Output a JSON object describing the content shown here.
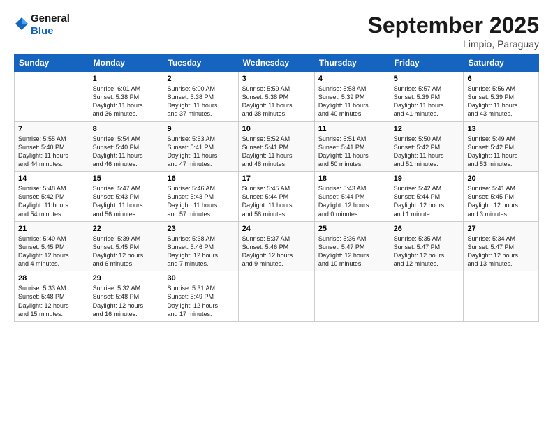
{
  "header": {
    "logo_general": "General",
    "logo_blue": "Blue",
    "month_title": "September 2025",
    "location": "Limpio, Paraguay"
  },
  "columns": [
    "Sunday",
    "Monday",
    "Tuesday",
    "Wednesday",
    "Thursday",
    "Friday",
    "Saturday"
  ],
  "weeks": [
    [
      {
        "day": "",
        "info": ""
      },
      {
        "day": "1",
        "info": "Sunrise: 6:01 AM\nSunset: 5:38 PM\nDaylight: 11 hours\nand 36 minutes."
      },
      {
        "day": "2",
        "info": "Sunrise: 6:00 AM\nSunset: 5:38 PM\nDaylight: 11 hours\nand 37 minutes."
      },
      {
        "day": "3",
        "info": "Sunrise: 5:59 AM\nSunset: 5:38 PM\nDaylight: 11 hours\nand 38 minutes."
      },
      {
        "day": "4",
        "info": "Sunrise: 5:58 AM\nSunset: 5:39 PM\nDaylight: 11 hours\nand 40 minutes."
      },
      {
        "day": "5",
        "info": "Sunrise: 5:57 AM\nSunset: 5:39 PM\nDaylight: 11 hours\nand 41 minutes."
      },
      {
        "day": "6",
        "info": "Sunrise: 5:56 AM\nSunset: 5:39 PM\nDaylight: 11 hours\nand 43 minutes."
      }
    ],
    [
      {
        "day": "7",
        "info": "Sunrise: 5:55 AM\nSunset: 5:40 PM\nDaylight: 11 hours\nand 44 minutes."
      },
      {
        "day": "8",
        "info": "Sunrise: 5:54 AM\nSunset: 5:40 PM\nDaylight: 11 hours\nand 46 minutes."
      },
      {
        "day": "9",
        "info": "Sunrise: 5:53 AM\nSunset: 5:41 PM\nDaylight: 11 hours\nand 47 minutes."
      },
      {
        "day": "10",
        "info": "Sunrise: 5:52 AM\nSunset: 5:41 PM\nDaylight: 11 hours\nand 48 minutes."
      },
      {
        "day": "11",
        "info": "Sunrise: 5:51 AM\nSunset: 5:41 PM\nDaylight: 11 hours\nand 50 minutes."
      },
      {
        "day": "12",
        "info": "Sunrise: 5:50 AM\nSunset: 5:42 PM\nDaylight: 11 hours\nand 51 minutes."
      },
      {
        "day": "13",
        "info": "Sunrise: 5:49 AM\nSunset: 5:42 PM\nDaylight: 11 hours\nand 53 minutes."
      }
    ],
    [
      {
        "day": "14",
        "info": "Sunrise: 5:48 AM\nSunset: 5:42 PM\nDaylight: 11 hours\nand 54 minutes."
      },
      {
        "day": "15",
        "info": "Sunrise: 5:47 AM\nSunset: 5:43 PM\nDaylight: 11 hours\nand 56 minutes."
      },
      {
        "day": "16",
        "info": "Sunrise: 5:46 AM\nSunset: 5:43 PM\nDaylight: 11 hours\nand 57 minutes."
      },
      {
        "day": "17",
        "info": "Sunrise: 5:45 AM\nSunset: 5:44 PM\nDaylight: 11 hours\nand 58 minutes."
      },
      {
        "day": "18",
        "info": "Sunrise: 5:43 AM\nSunset: 5:44 PM\nDaylight: 12 hours\nand 0 minutes."
      },
      {
        "day": "19",
        "info": "Sunrise: 5:42 AM\nSunset: 5:44 PM\nDaylight: 12 hours\nand 1 minute."
      },
      {
        "day": "20",
        "info": "Sunrise: 5:41 AM\nSunset: 5:45 PM\nDaylight: 12 hours\nand 3 minutes."
      }
    ],
    [
      {
        "day": "21",
        "info": "Sunrise: 5:40 AM\nSunset: 5:45 PM\nDaylight: 12 hours\nand 4 minutes."
      },
      {
        "day": "22",
        "info": "Sunrise: 5:39 AM\nSunset: 5:45 PM\nDaylight: 12 hours\nand 6 minutes."
      },
      {
        "day": "23",
        "info": "Sunrise: 5:38 AM\nSunset: 5:46 PM\nDaylight: 12 hours\nand 7 minutes."
      },
      {
        "day": "24",
        "info": "Sunrise: 5:37 AM\nSunset: 5:46 PM\nDaylight: 12 hours\nand 9 minutes."
      },
      {
        "day": "25",
        "info": "Sunrise: 5:36 AM\nSunset: 5:47 PM\nDaylight: 12 hours\nand 10 minutes."
      },
      {
        "day": "26",
        "info": "Sunrise: 5:35 AM\nSunset: 5:47 PM\nDaylight: 12 hours\nand 12 minutes."
      },
      {
        "day": "27",
        "info": "Sunrise: 5:34 AM\nSunset: 5:47 PM\nDaylight: 12 hours\nand 13 minutes."
      }
    ],
    [
      {
        "day": "28",
        "info": "Sunrise: 5:33 AM\nSunset: 5:48 PM\nDaylight: 12 hours\nand 15 minutes."
      },
      {
        "day": "29",
        "info": "Sunrise: 5:32 AM\nSunset: 5:48 PM\nDaylight: 12 hours\nand 16 minutes."
      },
      {
        "day": "30",
        "info": "Sunrise: 5:31 AM\nSunset: 5:49 PM\nDaylight: 12 hours\nand 17 minutes."
      },
      {
        "day": "",
        "info": ""
      },
      {
        "day": "",
        "info": ""
      },
      {
        "day": "",
        "info": ""
      },
      {
        "day": "",
        "info": ""
      }
    ]
  ]
}
